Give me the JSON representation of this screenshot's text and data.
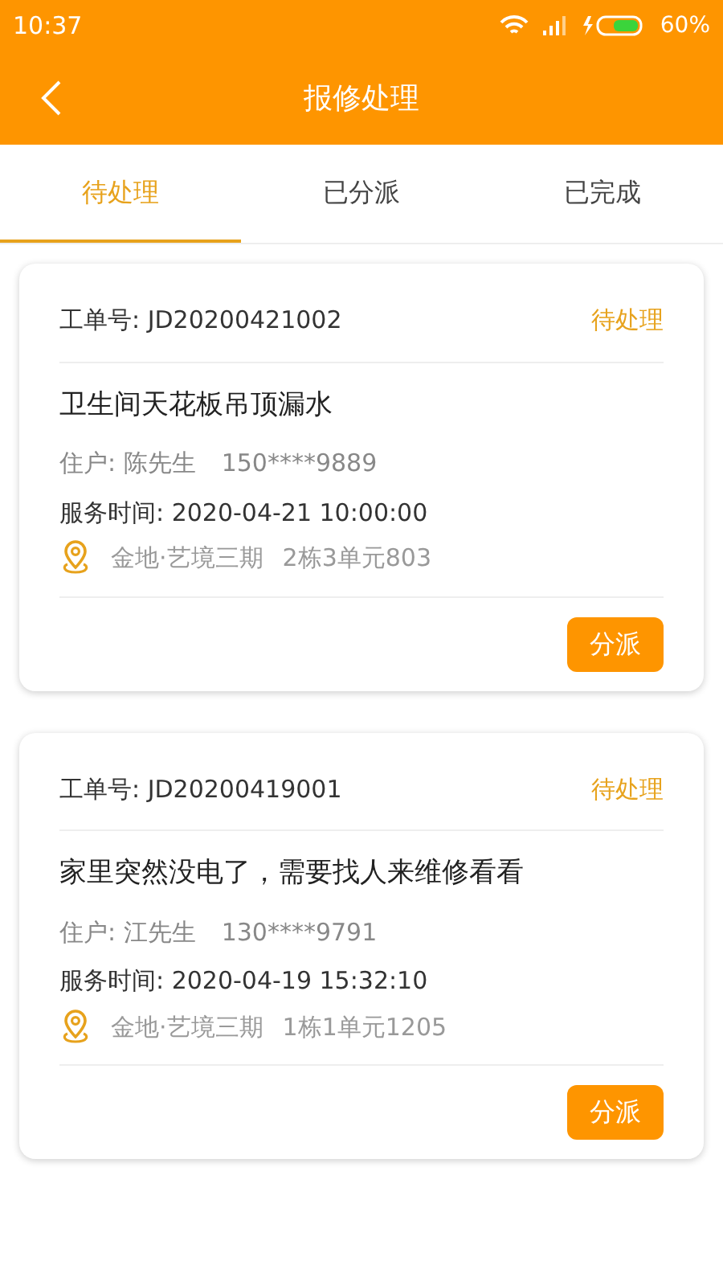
{
  "status_bar": {
    "time": "10:37",
    "battery": "60%"
  },
  "header": {
    "title": "报修处理"
  },
  "tabs": [
    {
      "label": "待处理",
      "selected": true
    },
    {
      "label": "已分派",
      "selected": false
    },
    {
      "label": "已完成",
      "selected": false
    }
  ],
  "orders": [
    {
      "order_no": "工单号: JD20200421002",
      "status": "待处理",
      "title": "卫生间天花板吊顶漏水",
      "resident": "住户: 陈先生",
      "phone": "150****9889",
      "service_time": "服务时间: 2020-04-21 10:00:00",
      "community": "金地·艺境三期",
      "unit": "2栋3单元803",
      "action": "分派"
    },
    {
      "order_no": "工单号: JD20200419001",
      "status": "待处理",
      "title": "家里突然没电了，需要找人来维修看看",
      "resident": "住户: 江先生",
      "phone": "130****9791",
      "service_time": "服务时间: 2020-04-19 15:32:10",
      "community": "金地·艺境三期",
      "unit": "1栋1单元1205",
      "action": "分派"
    }
  ]
}
